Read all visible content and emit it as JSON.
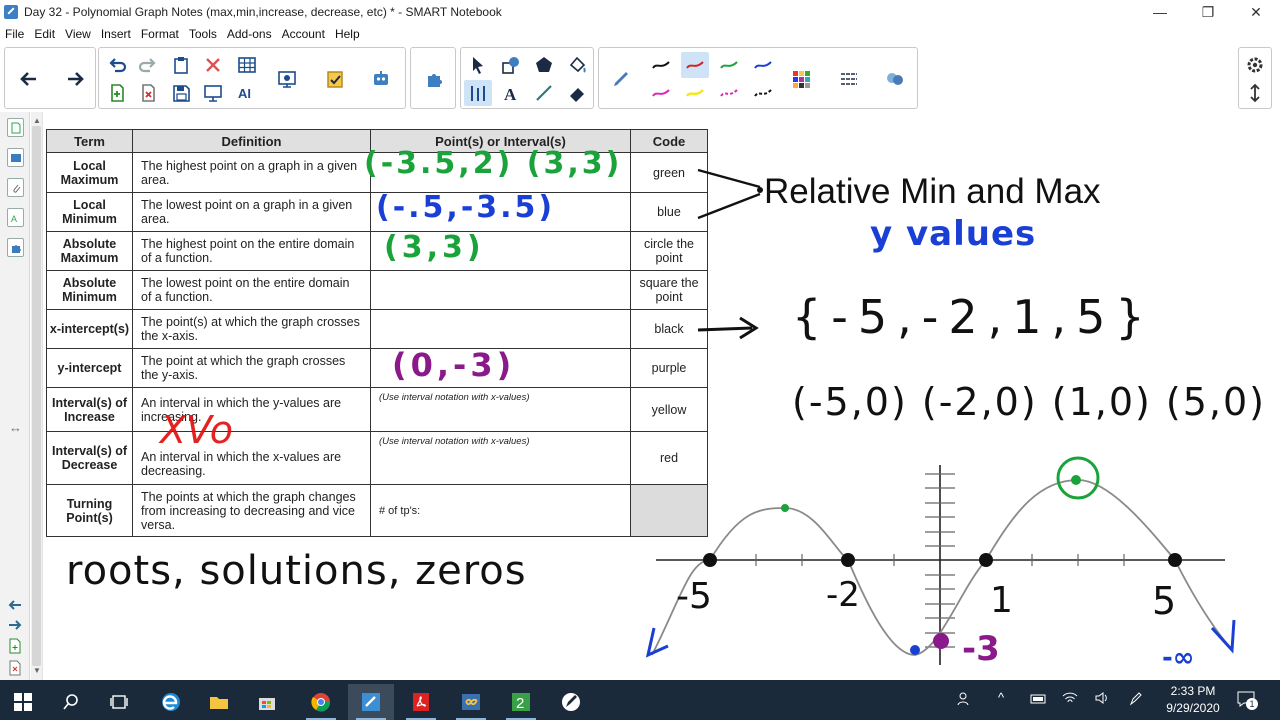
{
  "window": {
    "title": "Day 32 - Polynomial Graph Notes (max,min,increase, decrease, etc) * - SMART Notebook",
    "minimize": "—",
    "maximize": "❐",
    "close": "✕"
  },
  "menu": [
    "File",
    "Edit",
    "View",
    "Insert",
    "Format",
    "Tools",
    "Add-ons",
    "Account",
    "Help"
  ],
  "table": {
    "headers": [
      "Term",
      "Definition",
      "Point(s) or Interval(s)",
      "Code"
    ],
    "rows": [
      {
        "term": "Local Maximum",
        "definition": "The highest point on a graph in a given area.",
        "points": "",
        "code": "green"
      },
      {
        "term": "Local Minimum",
        "definition": "The lowest point on a graph in a given area.",
        "points": "",
        "code": "blue"
      },
      {
        "term": "Absolute Maximum",
        "definition": "The highest point on the entire domain of a function.",
        "points": "",
        "code": "circle the point"
      },
      {
        "term": "Absolute Minimum",
        "definition": "The lowest point on the entire domain of a function.",
        "points": "",
        "code": "square the point"
      },
      {
        "term": "x-intercept(s)",
        "definition": "The point(s) at which the graph crosses the x-axis.",
        "points": "",
        "code": "black"
      },
      {
        "term": "y-intercept",
        "definition": "The point at which the graph crosses the y-axis.",
        "points": "",
        "code": "purple"
      },
      {
        "term": "Interval(s) of Increase",
        "definition": "An interval in which the y-values are increasing.",
        "points": "(Use interval notation with x-values)",
        "code": "yellow"
      },
      {
        "term": "Interval(s) of Decrease",
        "definition": "An interval in which the x-values are decreasing.",
        "points": "(Use interval notation with x-values)",
        "code": "red"
      },
      {
        "term": "Turning Point(s)",
        "definition": "The points at which the graph changes from increasing to decreasing and vice versa.",
        "points": "# of tp's:",
        "code": ""
      }
    ]
  },
  "handwriting": {
    "local_max_points": "(-3.5,2) (3,3)",
    "local_min_points": "(-.5,-3.5)",
    "abs_max_points": "(3,3)",
    "y_intercept_points": "(0,-3)",
    "xvo": "XVo",
    "relative_label": "Relative Min and Max",
    "y_values": "y values",
    "roots_set": "{-5,-2,1,5}",
    "roots_points": "(-5,0) (-2,0) (1,0) (5,0)",
    "roots_words": "roots, solutions, zeros",
    "graph_labels": {
      "neg5": "-5",
      "neg2": "-2",
      "one": "1",
      "five": "5",
      "neg3": "-3",
      "neg_inf_left": "-∞",
      "neg_inf_right": "-∞"
    }
  },
  "colors": {
    "green": "#1aa33a",
    "blue": "#1a3fd4",
    "purple": "#8a1a8a",
    "red": "#e31010",
    "black": "#111111",
    "accent": "#2f7fc1"
  },
  "taskbar": {
    "time": "2:33 PM",
    "date": "9/29/2020",
    "notification_count": "1"
  }
}
